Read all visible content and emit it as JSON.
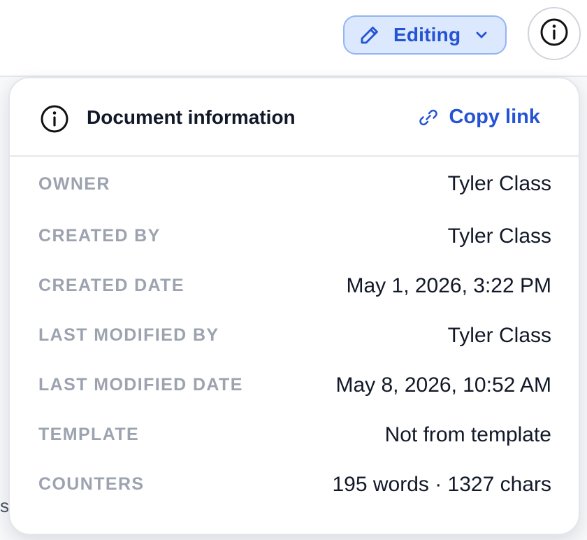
{
  "toolbar": {
    "mode_label": "Editing",
    "mode_icon": "pencil-icon",
    "info_icon": "info-icon"
  },
  "background": {
    "fragment_text": "s."
  },
  "panel": {
    "title": "Document information",
    "copy_link_label": "Copy link",
    "rows": [
      {
        "key": "OWNER",
        "value": "Tyler Class"
      },
      {
        "key": "CREATED BY",
        "value": "Tyler Class"
      },
      {
        "key": "CREATED DATE",
        "value": "May 1, 2026, 3:22 PM"
      },
      {
        "key": "LAST MODIFIED BY",
        "value": "Tyler Class"
      },
      {
        "key": "LAST MODIFIED DATE",
        "value": "May 8, 2026, 10:52 AM"
      },
      {
        "key": "TEMPLATE",
        "value": "Not from template"
      },
      {
        "key": "COUNTERS",
        "value": "195 words · 1327 chars"
      }
    ]
  },
  "colors": {
    "accent": "#2453d4",
    "accent_bg": "#dbe8fd",
    "label_gray": "#9ca3af",
    "text": "#111827"
  }
}
